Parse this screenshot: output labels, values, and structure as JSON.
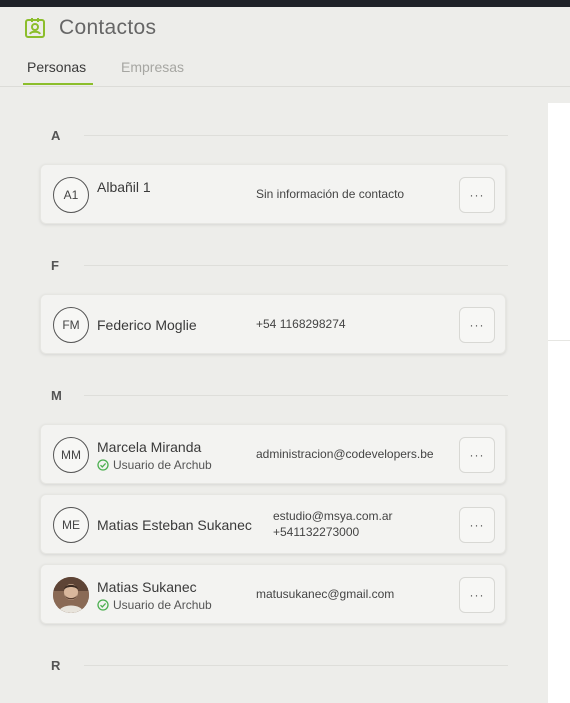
{
  "header": {
    "title": "Contactos",
    "title_icon": "contact-badge-icon",
    "accent_color": "#8cbe2c",
    "tabs": [
      {
        "label": "Personas",
        "active": true
      },
      {
        "label": "Empresas",
        "active": false
      }
    ]
  },
  "groups": [
    {
      "letter": "A",
      "contacts": [
        {
          "initials": "A1",
          "name": "Albañil 1",
          "subtitle": "",
          "info": [
            "Sin información de contacto"
          ],
          "more": "···"
        }
      ]
    },
    {
      "letter": "F",
      "contacts": [
        {
          "initials": "FM",
          "name": "Federico Moglie",
          "subtitle": "",
          "info": [
            "+54 1168298274"
          ],
          "more": "···"
        }
      ]
    },
    {
      "letter": "M",
      "contacts": [
        {
          "initials": "MM",
          "name": "Marcela Miranda",
          "subtitle": "Usuario de Archub",
          "info": [
            "administracion@codevelopers.be"
          ],
          "more": "···"
        },
        {
          "initials": "ME",
          "name": "Matias Esteban Sukanec",
          "subtitle": "",
          "info": [
            "estudio@msya.com.ar",
            "+541132273000"
          ],
          "more": "···"
        },
        {
          "initials": "",
          "name": "Matias Sukanec",
          "subtitle": "Usuario de Archub",
          "info": [
            "matusukanec@gmail.com"
          ],
          "more": "···",
          "avatar": "photo"
        }
      ]
    },
    {
      "letter": "R",
      "contacts": []
    }
  ]
}
